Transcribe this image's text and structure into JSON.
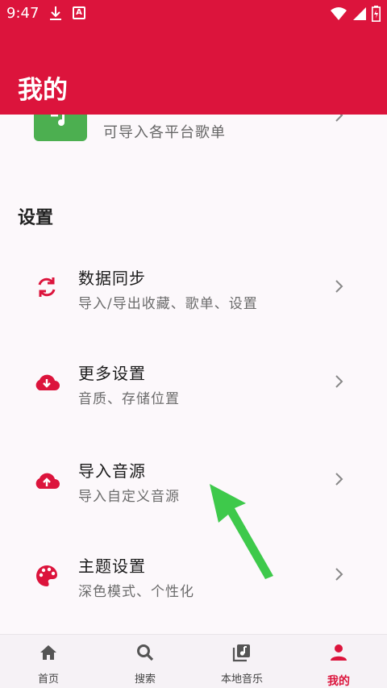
{
  "status_bar": {
    "time": "9:47",
    "icons": [
      "download-icon",
      "a-badge-icon",
      "wifi-icon",
      "signal-icon",
      "battery-icon"
    ]
  },
  "app_bar": {
    "title": "我的"
  },
  "partial_row": {
    "subtitle": "可导入各平台歌单",
    "icon": "music-note-icon"
  },
  "settings": {
    "header": "设置",
    "items": [
      {
        "label": "数据同步",
        "sub": "导入/导出收藏、歌单、设置",
        "icon": "sync-icon"
      },
      {
        "label": "更多设置",
        "sub": "音质、存储位置",
        "icon": "cloud-download-icon"
      },
      {
        "label": "导入音源",
        "sub": "导入自定义音源",
        "icon": "cloud-upload-icon"
      },
      {
        "label": "主题设置",
        "sub": "深色模式、个性化",
        "icon": "palette-icon"
      }
    ]
  },
  "bottom_nav": {
    "items": [
      {
        "label": "首页",
        "icon": "home-icon",
        "active": false
      },
      {
        "label": "搜索",
        "icon": "search-icon",
        "active": false
      },
      {
        "label": "本地音乐",
        "icon": "library-music-icon",
        "active": false
      },
      {
        "label": "我的",
        "icon": "person-icon",
        "active": true
      }
    ]
  },
  "colors": {
    "primary": "#dc143c",
    "green_tile": "#4caf50",
    "annotation_arrow": "#3ec94b"
  }
}
